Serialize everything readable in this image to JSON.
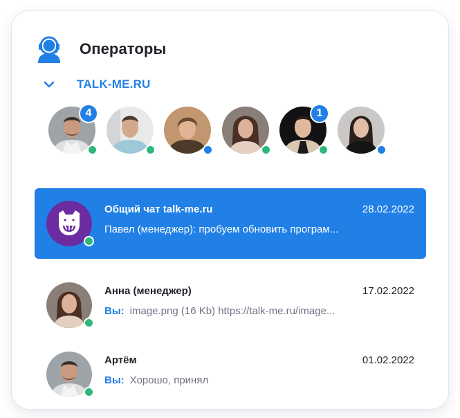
{
  "header": {
    "title": "Операторы",
    "icon": "operator-headset-icon"
  },
  "group": {
    "name": "TALK-ME.RU",
    "icon": "chevron-down-icon"
  },
  "colors": {
    "accent": "#2180e6",
    "online": "#2fb67c",
    "away": "#2180e6"
  },
  "operators": [
    {
      "badge": "4",
      "status": "online"
    },
    {
      "badge": "",
      "status": "online"
    },
    {
      "badge": "",
      "status": "away"
    },
    {
      "badge": "",
      "status": "online"
    },
    {
      "badge": "1",
      "status": "online"
    },
    {
      "badge": "",
      "status": "away"
    }
  ],
  "chats": [
    {
      "name": "Общий чат talk-me.ru",
      "date": "28.02.2022",
      "you": "",
      "preview": "Павел (менеджер): пробуем обновить програм...",
      "active": true
    },
    {
      "name": "Анна (менеджер)",
      "date": "17.02.2022",
      "you": "Вы:",
      "preview": "image.png (16 Kb) https://talk-me.ru/image...",
      "active": false
    },
    {
      "name": "Артём",
      "date": "01.02.2022",
      "you": "Вы:",
      "preview": "Хорошо, принял",
      "active": false
    }
  ]
}
